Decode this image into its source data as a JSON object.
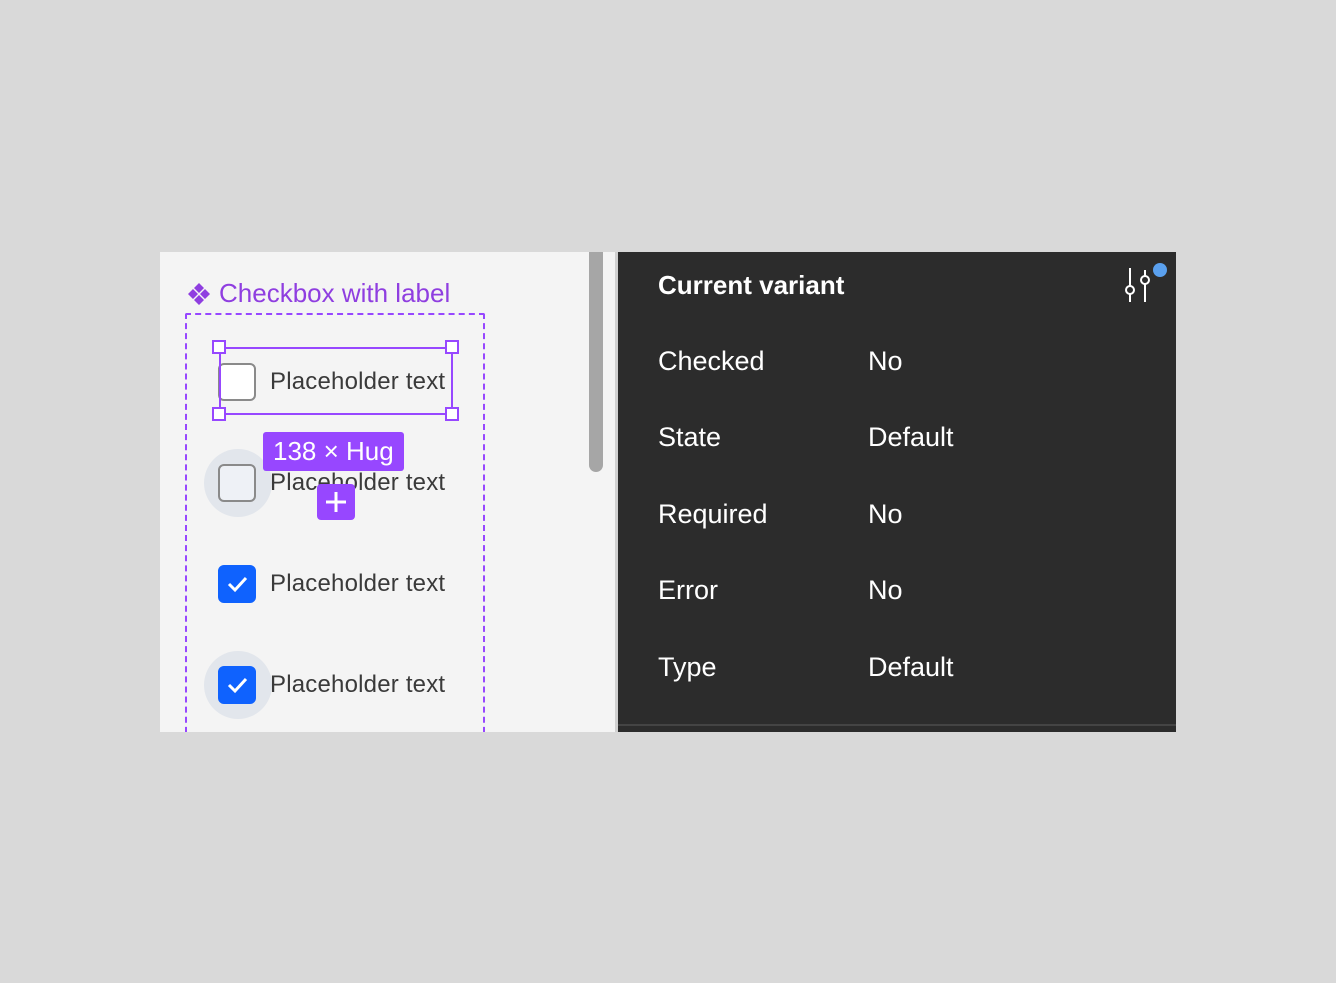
{
  "component": {
    "title": "Checkbox with label",
    "icon": "component-icon",
    "selection_size": "138 × Hug",
    "rows": [
      {
        "label": "Placeholder text",
        "state": "unchecked"
      },
      {
        "label": "Placeholder text",
        "state": "unchecked-hover"
      },
      {
        "label": "Placeholder text",
        "state": "checked"
      },
      {
        "label": "Placeholder text",
        "state": "checked-hover"
      }
    ]
  },
  "panel": {
    "title": "Current variant",
    "settings_icon": "adjustments-icon",
    "properties": [
      {
        "name": "Checked",
        "value": "No"
      },
      {
        "name": "State",
        "value": "Default"
      },
      {
        "name": "Required",
        "value": "No"
      },
      {
        "name": "Error",
        "value": "No"
      },
      {
        "name": "Type",
        "value": "Default"
      }
    ]
  },
  "colors": {
    "selection": "#9747ff",
    "checkbox_checked": "#0f62fe",
    "panel_bg": "#2c2c2c",
    "notification_dot": "#5aa0ee"
  }
}
